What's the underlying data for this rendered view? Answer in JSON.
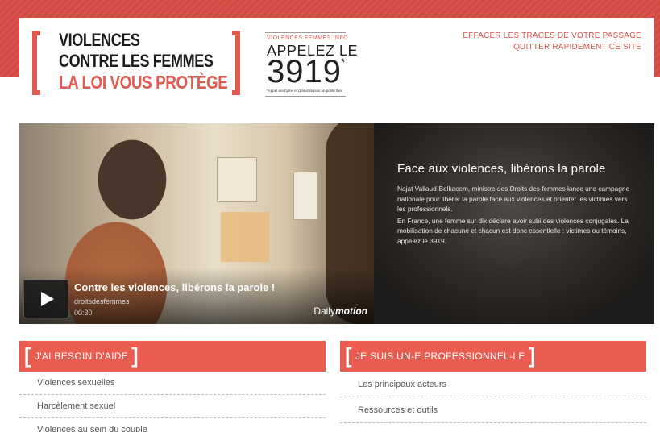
{
  "header": {
    "logo": {
      "line1": "VIOLENCES",
      "line2": "CONTRE LES FEMMES",
      "line3": "LA LOI VOUS PROTÈGE"
    },
    "hotline": {
      "label": "VIOLENCES FEMMES INFO",
      "call": "APPELEZ LE",
      "number": "3919",
      "star": "*",
      "footnote": "*Appel anonyme et gratuit depuis un poste fixe."
    },
    "quick_links": {
      "erase": "EFFACER LES TRACES DE VOTRE PASSAGE",
      "quit": "QUITTER RAPIDEMENT CE SITE"
    }
  },
  "video": {
    "title": "Contre les violences, libérons la parole !",
    "owner": "droitsdesfemmes",
    "duration": "00:30",
    "brand_prefix": "Daily",
    "brand_suffix": "motion"
  },
  "feature": {
    "title": "Face aux violences, libérons la parole",
    "para1": "Najat Vallaud-Belkacem, ministre des Droits des femmes lance une campagne nationale pour libérer la parole face aux violences et orienter les victimes vers les professionnels.",
    "para2": "En France, une femme sur dix déclare avoir subi des violences conjugales. La mobilisation de chacune et chacun est donc essentielle : victimes ou témoins, appelez le 3919."
  },
  "help_section": {
    "bracket_open": "[",
    "bracket_close": "]",
    "title": "J'AI BESOIN D'AIDE",
    "items": [
      "Violences sexuelles",
      "Harcèlement sexuel",
      "Violences au sein du couple"
    ]
  },
  "pro_section": {
    "bracket_open": "[",
    "bracket_close": "]",
    "title": "JE SUIS UN-E PROFESSIONNEL-LE",
    "items": [
      "Les principaux acteurs",
      "Ressources et outils"
    ]
  },
  "colors": {
    "accent": "#ea5b50",
    "band": "#d9534b"
  }
}
